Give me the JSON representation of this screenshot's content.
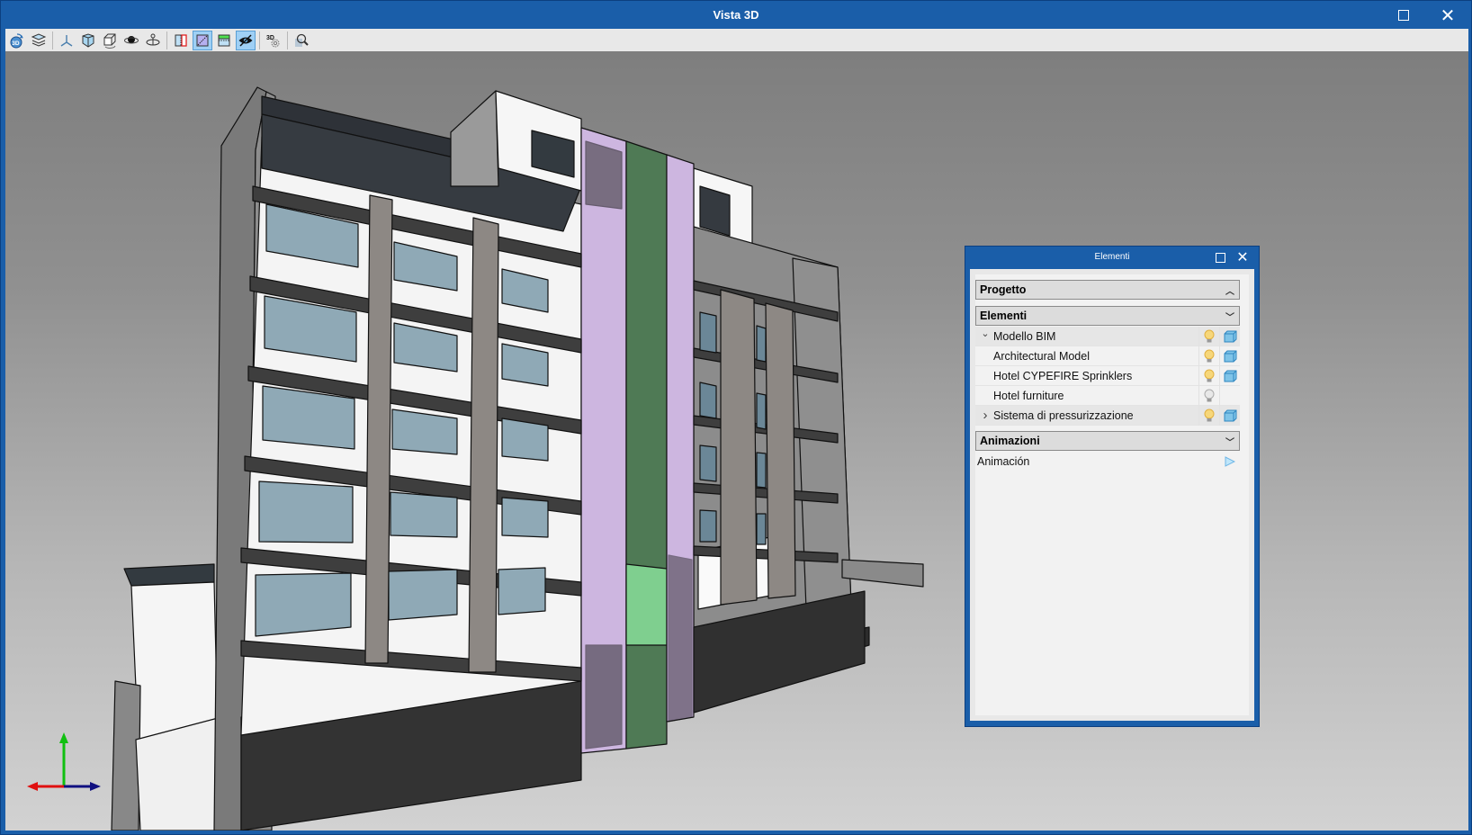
{
  "window": {
    "title": "Vista 3D",
    "maximize_label": "Maximize",
    "close_label": "Close"
  },
  "toolbar": {
    "groups": [
      [
        {
          "icon": "rotate-3d-icon",
          "active": false
        },
        {
          "icon": "layers-icon",
          "active": false
        }
      ],
      [
        {
          "icon": "axes-icon",
          "active": false
        },
        {
          "icon": "cube-view-icon",
          "active": false
        },
        {
          "icon": "section-box-icon",
          "active": false
        },
        {
          "icon": "orbit-icon",
          "active": false
        },
        {
          "icon": "walk-rotate-icon",
          "active": false
        }
      ],
      [
        {
          "icon": "vertical-clip-icon",
          "active": false
        },
        {
          "icon": "diagonal-clip-icon",
          "active": true
        },
        {
          "icon": "horizontal-clip-icon",
          "active": false
        },
        {
          "icon": "hide-eye-icon",
          "active": true
        }
      ],
      [
        {
          "icon": "3d-settings-icon",
          "active": false
        }
      ],
      [
        {
          "icon": "zoom-icon",
          "active": false
        }
      ]
    ]
  },
  "viewport": {
    "description": "3D BIM model of multi-storey hotel building, sectioned view",
    "axis_colors": {
      "x": "#e01010",
      "y": "#10c010",
      "z": "#101080"
    }
  },
  "panel": {
    "title": "Elementi",
    "sections": {
      "progetto": {
        "label": "Progetto",
        "expanded": true
      },
      "elementi": {
        "label": "Elementi",
        "expanded": true
      },
      "animazioni": {
        "label": "Animazioni",
        "expanded": true
      }
    },
    "tree": [
      {
        "label": "Modello BIM",
        "level": 0,
        "expander": "expanded",
        "visible": true,
        "has_model_icon": true
      },
      {
        "label": "Architectural Model",
        "level": 1,
        "expander": "none",
        "visible": true,
        "has_model_icon": true
      },
      {
        "label": "Hotel CYPEFIRE Sprinklers",
        "level": 1,
        "expander": "none",
        "visible": true,
        "has_model_icon": true
      },
      {
        "label": "Hotel furniture",
        "level": 1,
        "expander": "none",
        "visible": false,
        "has_model_icon": false
      },
      {
        "label": "Sistema di pressurizzazione",
        "level": 0,
        "expander": "collapsed",
        "visible": true,
        "has_model_icon": true
      }
    ],
    "animations": [
      {
        "label": "Animación",
        "action_icon": "play-icon"
      }
    ]
  },
  "colors": {
    "titlebar": "#1a5ea9",
    "bulb_on": "#f7d77a",
    "bulb_off": "#e8e8e8",
    "cube": "#7fc4e8",
    "shaft_purple": "#cdb6e0",
    "shaft_green": "#4f7a55"
  }
}
